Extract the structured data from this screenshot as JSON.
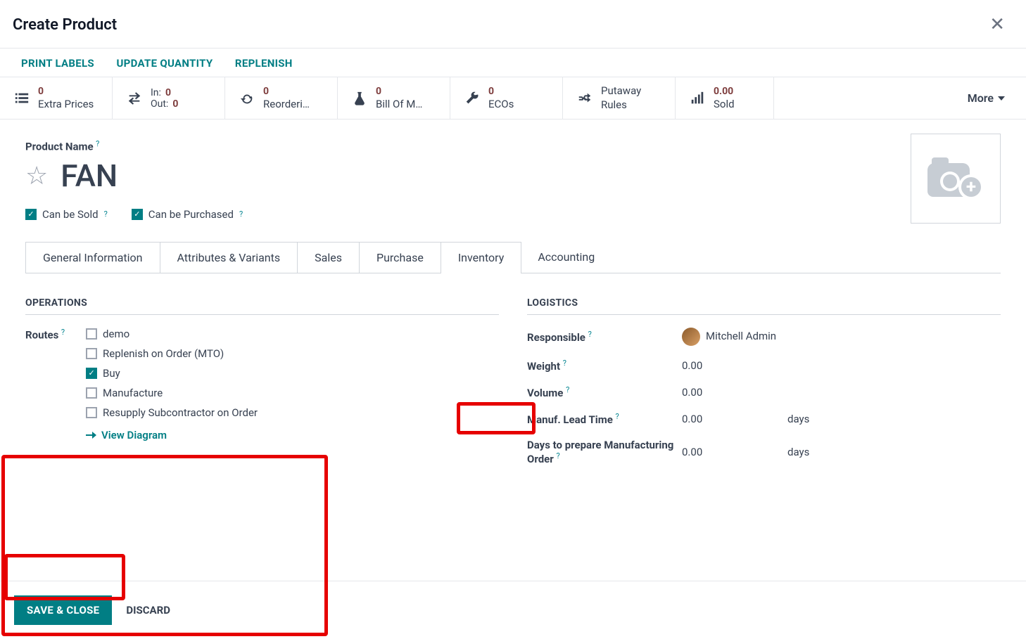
{
  "modal": {
    "title": "Create Product"
  },
  "actions": {
    "print": "PRINT LABELS",
    "update_qty": "UPDATE QUANTITY",
    "replenish": "REPLENISH"
  },
  "stats": {
    "extra_prices": {
      "value": "0",
      "label": "Extra Prices"
    },
    "io": {
      "in_label": "In:",
      "in_value": "0",
      "out_label": "Out:",
      "out_value": "0"
    },
    "reorder": {
      "value": "0",
      "label": "Reorderi…"
    },
    "bom": {
      "value": "0",
      "label": "Bill Of M…"
    },
    "ecos": {
      "value": "0",
      "label": "ECOs"
    },
    "putaway": {
      "line1": "Putaway",
      "line2": "Rules"
    },
    "sold": {
      "value": "0.00",
      "label": "Sold"
    },
    "more": "More"
  },
  "product": {
    "name_label": "Product Name",
    "name": "FAN",
    "can_be_sold": "Can be Sold",
    "can_be_purchased": "Can be Purchased"
  },
  "tabs": {
    "general": "General Information",
    "attrs": "Attributes & Variants",
    "sales": "Sales",
    "purchase": "Purchase",
    "inventory": "Inventory",
    "accounting": "Accounting"
  },
  "inventory": {
    "operations_title": "OPERATIONS",
    "routes_label": "Routes",
    "routes": {
      "demo": "demo",
      "mto": "Replenish on Order (MTO)",
      "buy": "Buy",
      "manufacture": "Manufacture",
      "resupply": "Resupply Subcontractor on Order"
    },
    "view_diagram": "View Diagram",
    "logistics_title": "LOGISTICS",
    "responsible_label": "Responsible",
    "responsible_value": "Mitchell Admin",
    "weight_label": "Weight",
    "weight_value": "0.00",
    "volume_label": "Volume",
    "volume_value": "0.00",
    "manuf_lead_label": "Manuf. Lead Time",
    "manuf_lead_value": "0.00",
    "manuf_lead_unit": "days",
    "prep_label": "Days to prepare Manufacturing Order",
    "prep_value": "0.00",
    "prep_unit": "days"
  },
  "footer": {
    "save": "SAVE & CLOSE",
    "discard": "DISCARD"
  }
}
